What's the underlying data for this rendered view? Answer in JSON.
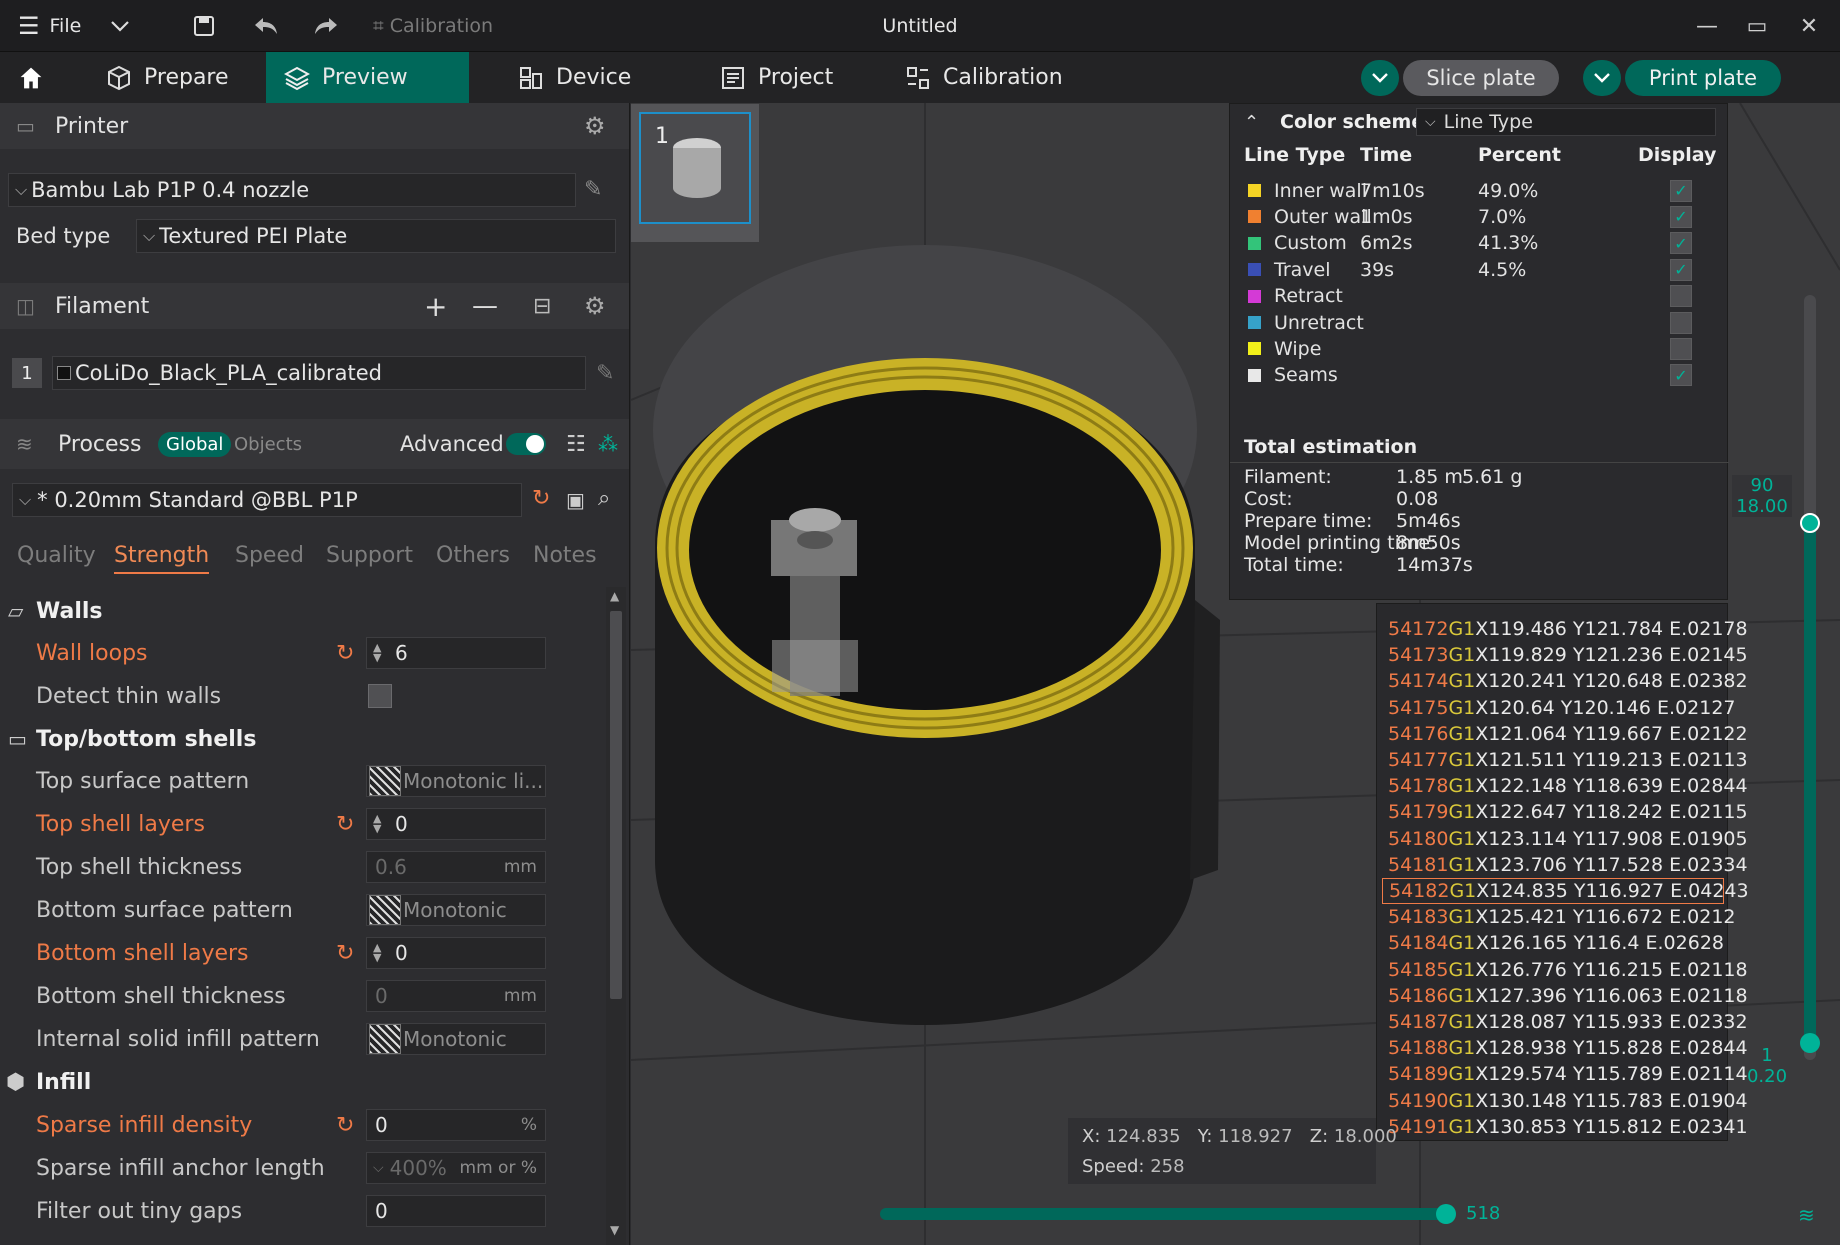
{
  "titlebar": {
    "file_menu": "File",
    "calibration": "Calibration",
    "window_title": "Untitled"
  },
  "nav": {
    "home": "home",
    "prepare": "Prepare",
    "preview": "Preview",
    "device": "Device",
    "project": "Project",
    "calibration": "Calibration",
    "slice_plate": "Slice plate",
    "print_plate": "Print plate"
  },
  "printer": {
    "header": "Printer",
    "model": "Bambu Lab P1P 0.4 nozzle",
    "bed_label": "Bed type",
    "bed_value": "Textured PEI Plate"
  },
  "filament": {
    "header": "Filament",
    "index": "1",
    "name": "CoLiDo_Black_PLA_calibrated"
  },
  "process": {
    "header": "Process",
    "global": "Global",
    "objects": "Objects",
    "advanced": "Advanced",
    "preset": "* 0.20mm Standard @BBL P1P",
    "tabs": [
      "Quality",
      "Strength",
      "Speed",
      "Support",
      "Others",
      "Notes"
    ],
    "active_tab": "Strength"
  },
  "settings": {
    "walls": "Walls",
    "wall_loops_label": "Wall loops",
    "wall_loops_value": "6",
    "detect_thin_walls": "Detect thin walls",
    "top_bottom": "Top/bottom shells",
    "top_surface_pattern_label": "Top surface pattern",
    "top_surface_pattern_value": "Monotonic li...",
    "top_shell_layers_label": "Top shell layers",
    "top_shell_layers_value": "0",
    "top_shell_thickness_label": "Top shell thickness",
    "top_shell_thickness_value": "0.6",
    "bottom_surface_pattern_label": "Bottom surface pattern",
    "bottom_surface_pattern_value": "Monotonic",
    "bottom_shell_layers_label": "Bottom shell layers",
    "bottom_shell_layers_value": "0",
    "bottom_shell_thickness_label": "Bottom shell thickness",
    "bottom_shell_thickness_value": "0",
    "internal_solid_label": "Internal solid infill pattern",
    "internal_solid_value": "Monotonic",
    "infill": "Infill",
    "sparse_density_label": "Sparse infill density",
    "sparse_density_value": "0",
    "anchor_label": "Sparse infill anchor length",
    "anchor_value": "400%",
    "anchor_unit": "mm or %",
    "tiny_gaps_label": "Filter out tiny gaps",
    "tiny_gaps_value": "0",
    "unit_mm": "mm",
    "unit_pct": "%"
  },
  "plate": {
    "number": "1"
  },
  "legend": {
    "color_scheme_label": "Color scheme",
    "color_scheme_value": "Line Type",
    "headers": {
      "type": "Line Type",
      "time": "Time",
      "percent": "Percent",
      "display": "Display"
    },
    "rows": [
      {
        "name": "Inner wall",
        "time": "7m10s",
        "percent": "49.0%",
        "color": "#f5d425",
        "checked": true
      },
      {
        "name": "Outer wall",
        "time": "1m0s",
        "percent": "7.0%",
        "color": "#f08030",
        "checked": true
      },
      {
        "name": "Custom",
        "time": "6m2s",
        "percent": "41.3%",
        "color": "#33c47a",
        "checked": true
      },
      {
        "name": "Travel",
        "time": "39s",
        "percent": "4.5%",
        "color": "#3a4fb5",
        "checked": true
      },
      {
        "name": "Retract",
        "time": "",
        "percent": "",
        "color": "#d43ad6",
        "checked": false
      },
      {
        "name": "Unretract",
        "time": "",
        "percent": "",
        "color": "#36a2c9",
        "checked": false
      },
      {
        "name": "Wipe",
        "time": "",
        "percent": "",
        "color": "#f2f01a",
        "checked": false
      },
      {
        "name": "Seams",
        "time": "",
        "percent": "",
        "color": "#e8e8e8",
        "checked": true
      }
    ],
    "total_header": "Total estimation",
    "filament_label": "Filament:",
    "filament_value": "1.85 m",
    "filament_weight": "5.61 g",
    "cost_label": "Cost:",
    "cost_value": "0.08",
    "prepare_label": "Prepare time:",
    "prepare_value": "5m46s",
    "model_time_label": "Model printing time:",
    "model_time_value": "8m50s",
    "total_label": "Total time:",
    "total_value": "14m37s"
  },
  "gcode": [
    {
      "ln": "54172",
      "cmd": "G1",
      "args": "X119.486 Y121.784 E.02178"
    },
    {
      "ln": "54173",
      "cmd": "G1",
      "args": "X119.829 Y121.236 E.02145"
    },
    {
      "ln": "54174",
      "cmd": "G1",
      "args": "X120.241 Y120.648 E.02382"
    },
    {
      "ln": "54175",
      "cmd": "G1",
      "args": "X120.64 Y120.146 E.02127"
    },
    {
      "ln": "54176",
      "cmd": "G1",
      "args": "X121.064 Y119.667 E.02122"
    },
    {
      "ln": "54177",
      "cmd": "G1",
      "args": "X121.511 Y119.213 E.02113"
    },
    {
      "ln": "54178",
      "cmd": "G1",
      "args": "X122.148 Y118.639 E.02844"
    },
    {
      "ln": "54179",
      "cmd": "G1",
      "args": "X122.647 Y118.242 E.02115"
    },
    {
      "ln": "54180",
      "cmd": "G1",
      "args": "X123.114 Y117.908 E.01905"
    },
    {
      "ln": "54181",
      "cmd": "G1",
      "args": "X123.706 Y117.528 E.02334"
    },
    {
      "ln": "54182",
      "cmd": "G1",
      "args": "X124.835 Y116.927 E.04243",
      "selected": true
    },
    {
      "ln": "54183",
      "cmd": "G1",
      "args": "X125.421 Y116.672 E.0212"
    },
    {
      "ln": "54184",
      "cmd": "G1",
      "args": "X126.165 Y116.4 E.02628"
    },
    {
      "ln": "54185",
      "cmd": "G1",
      "args": "X126.776 Y116.215 E.02118"
    },
    {
      "ln": "54186",
      "cmd": "G1",
      "args": "X127.396 Y116.063 E.02118"
    },
    {
      "ln": "54187",
      "cmd": "G1",
      "args": "X128.087 Y115.933 E.02332"
    },
    {
      "ln": "54188",
      "cmd": "G1",
      "args": "X128.938 Y115.828 E.02844"
    },
    {
      "ln": "54189",
      "cmd": "G1",
      "args": "X129.574 Y115.789 E.02114"
    },
    {
      "ln": "54190",
      "cmd": "G1",
      "args": "X130.148 Y115.783 E.01904"
    },
    {
      "ln": "54191",
      "cmd": "G1",
      "args": "X130.853 Y115.812 E.02341"
    }
  ],
  "layer_slider": {
    "top_layer": "90",
    "top_height": "18.00",
    "bottom_layer": "1",
    "bottom_height": "0.20"
  },
  "position": {
    "x_label": "X:",
    "x": "124.835",
    "y_label": "Y:",
    "y": "118.927",
    "z_label": "Z:",
    "z": "18.000",
    "speed_label": "Speed:",
    "speed": "258"
  },
  "move_slider": {
    "value": "518"
  },
  "colors": {
    "accent": "#00685a",
    "accent_bright": "#00b398",
    "modified": "#ef7a47"
  }
}
